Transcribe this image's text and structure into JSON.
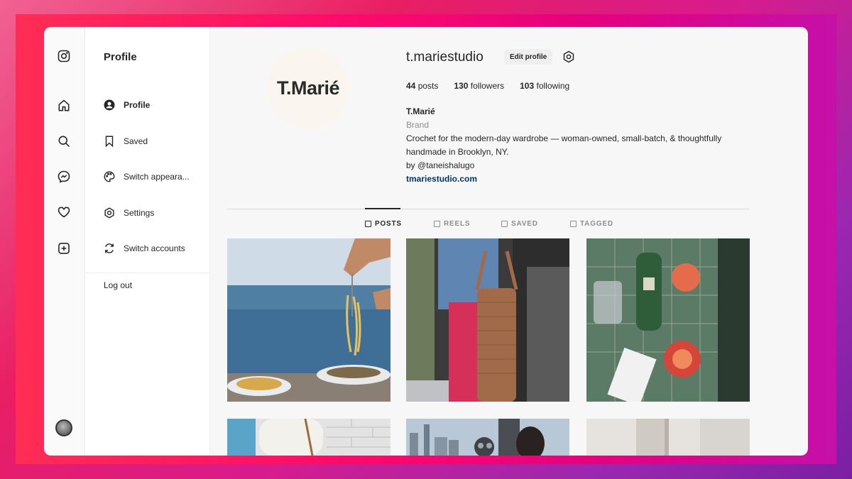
{
  "sidebar": {
    "title": "Profile",
    "items": [
      {
        "label": "Profile"
      },
      {
        "label": "Saved"
      },
      {
        "label": "Switch appeara..."
      },
      {
        "label": "Settings"
      },
      {
        "label": "Switch accounts"
      }
    ],
    "logout": "Log out"
  },
  "profile": {
    "avatar_text": "T.Marié",
    "username": "t.mariestudio",
    "edit_label": "Edit profile",
    "stats": [
      {
        "value": "44",
        "label": "posts"
      },
      {
        "value": "130",
        "label": "followers"
      },
      {
        "value": "103",
        "label": "following"
      }
    ],
    "bio": {
      "name": "T.Marié",
      "category": "Brand",
      "line1": "Crochet for the modern-day wardrobe — woman-owned, small-batch, & thoughtfully",
      "line2": "handmade in Brooklyn, NY.",
      "line3": "by @taneishalugo",
      "link": "tmariestudio.com"
    }
  },
  "tabs": [
    {
      "label": "POSTS"
    },
    {
      "label": "REELS"
    },
    {
      "label": "SAVED"
    },
    {
      "label": "TAGGED"
    }
  ],
  "icons": [
    "instagram-icon",
    "home-icon",
    "search-icon",
    "messenger-icon",
    "heart-icon",
    "create-icon"
  ],
  "colors": {
    "accent_link": "#00376b",
    "frame_pink": "#ff0a6a",
    "frame_purple": "#c510a8"
  }
}
